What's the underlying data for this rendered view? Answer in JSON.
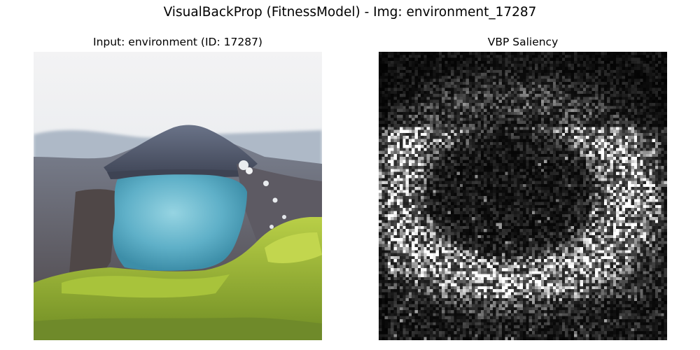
{
  "figure": {
    "suptitle": "VisualBackProp (FitnessModel) - Img: environment_17287"
  },
  "panels": {
    "input": {
      "title": "Input: environment (ID: 17287)",
      "image_subject": "aerial view of a blue crater lake surrounded by green mossy rim and grey mountain slopes under hazy white sky",
      "colors": {
        "sky": "#eeeff1",
        "haze": "#c7d0da",
        "mountain": "#586478",
        "ridge": "#4a4f5d",
        "lake": "#5fb0c8",
        "lake_light": "#8fd0df",
        "moss": "#8fae2c",
        "moss_light": "#b5cc45",
        "rock": "#5b4f4c",
        "snow": "#e9ecef"
      }
    },
    "saliency": {
      "title": "VBP Saliency",
      "colormap": "gray",
      "grid": [
        96,
        96
      ],
      "colors": {
        "background": "#050505",
        "highlight": "#ffffff"
      }
    }
  }
}
